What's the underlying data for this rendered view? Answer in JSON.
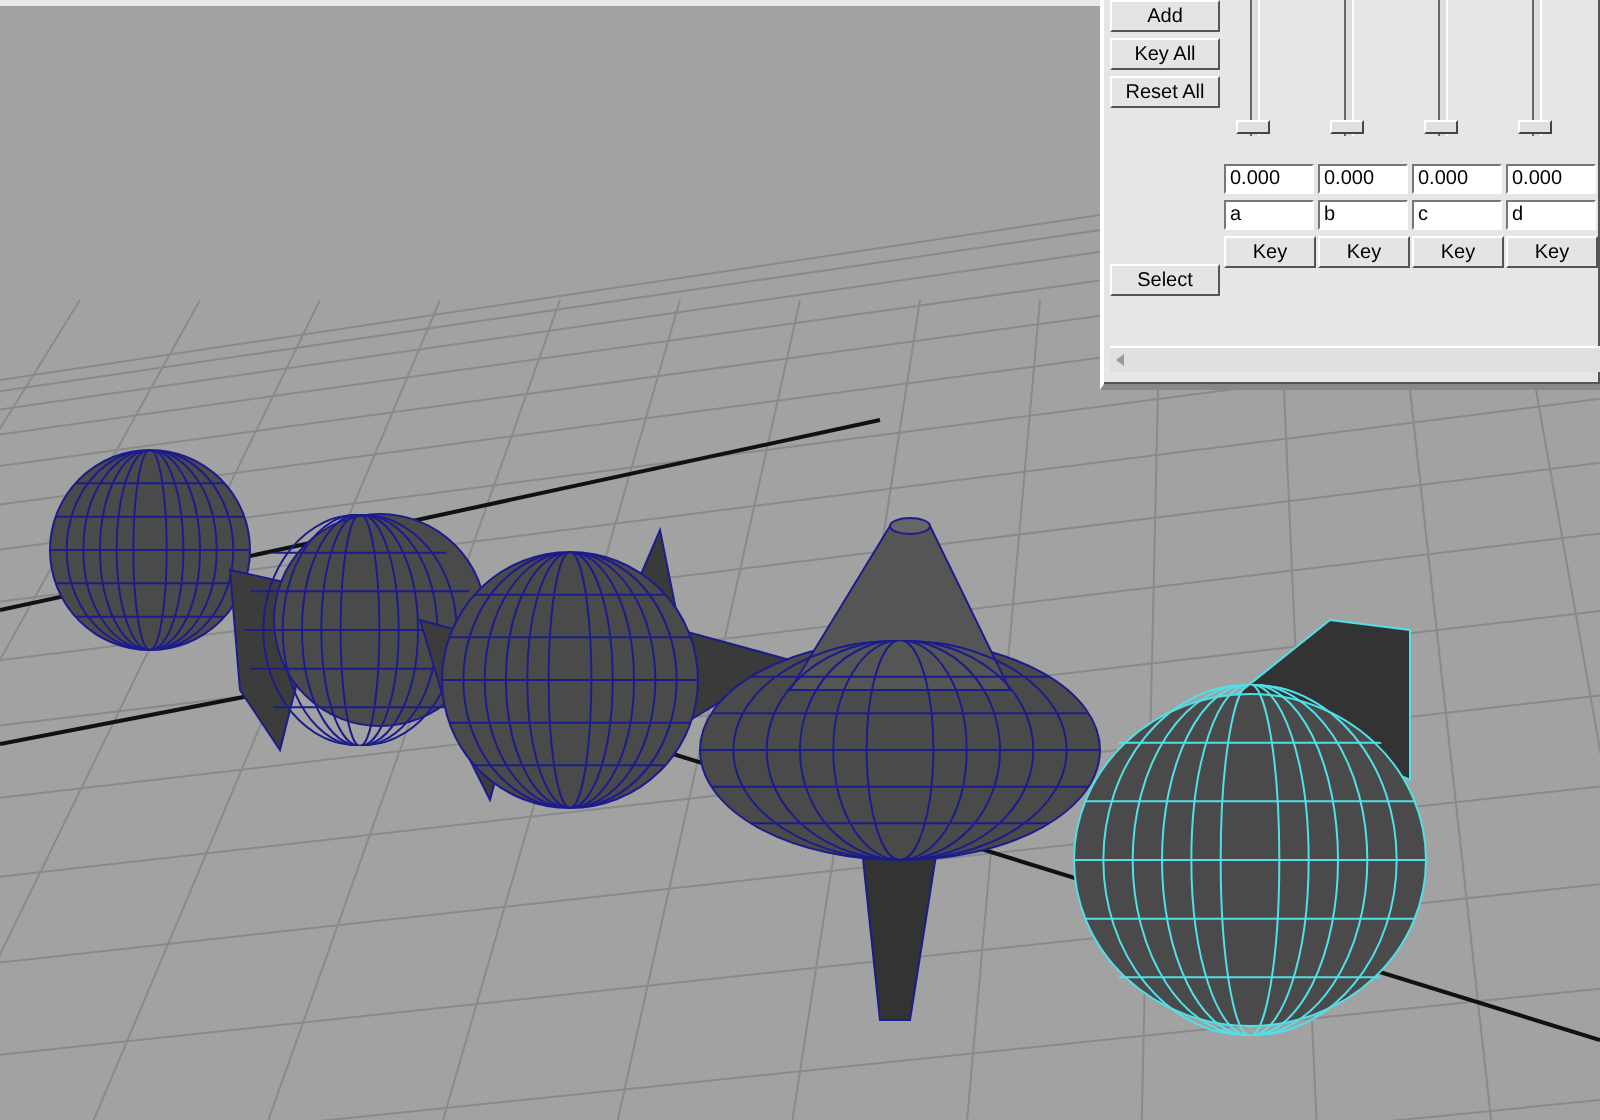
{
  "scene": {
    "objects": [
      {
        "kind": "sphere",
        "selected": false
      },
      {
        "kind": "spiked-sphere",
        "selected": false
      },
      {
        "kind": "eared-sphere",
        "selected": false
      },
      {
        "kind": "spinning-top",
        "selected": false
      },
      {
        "kind": "head",
        "selected": true
      }
    ]
  },
  "blend_panel": {
    "buttons": [
      "Add",
      "Key All",
      "Reset All"
    ],
    "select_button": "Select",
    "channels": [
      {
        "level": 0,
        "value": "0.000",
        "name": "a",
        "key_button": "Key"
      },
      {
        "level": 0,
        "value": "0.000",
        "name": "b",
        "key_button": "Key"
      },
      {
        "level": 0,
        "value": "0.000",
        "name": "c",
        "key_button": "Key"
      },
      {
        "level": 0,
        "value": "0.000",
        "name": "d",
        "key_button": "Key"
      }
    ]
  }
}
